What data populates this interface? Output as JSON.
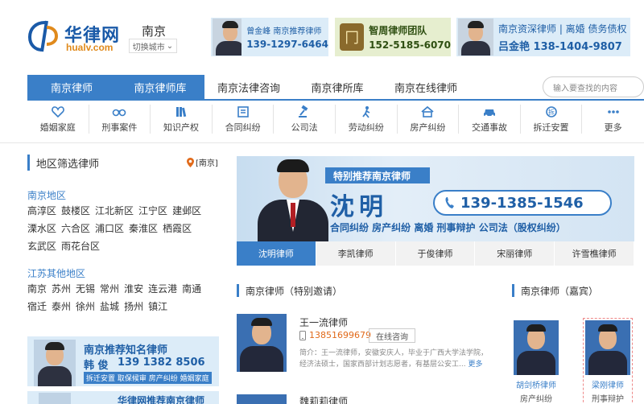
{
  "header": {
    "logo_cn": "华律网",
    "logo_en": "hualv.com",
    "city": "南京",
    "switch_city": "切换城市"
  },
  "ads": [
    {
      "line1": "曾金峰 南京推荐律师",
      "line2": "139-1297-6464"
    },
    {
      "line1": "智周律师团队",
      "line2": "152-5185-6070"
    },
    {
      "line1": "南京资深律师 | 离婚 债务债权",
      "line2": "吕金艳  138-1404-9807"
    }
  ],
  "nav": {
    "items": [
      "南京律师",
      "南京律师库",
      "南京法律咨询",
      "南京律所库",
      "南京在线律师"
    ],
    "search_placeholder": "输入要查找的内容"
  },
  "categories": [
    {
      "label": "婚姻家庭",
      "icon": "heart-icon"
    },
    {
      "label": "刑事案件",
      "icon": "handcuffs-icon"
    },
    {
      "label": "知识产权",
      "icon": "books-icon"
    },
    {
      "label": "合同纠纷",
      "icon": "contract-icon"
    },
    {
      "label": "公司法",
      "icon": "gavel-icon"
    },
    {
      "label": "劳动纠纷",
      "icon": "worker-icon"
    },
    {
      "label": "房产纠纷",
      "icon": "house-icon"
    },
    {
      "label": "交通事故",
      "icon": "car-icon"
    },
    {
      "label": "拆迁安置",
      "icon": "demolition-icon"
    },
    {
      "label": "更多",
      "icon": "more-icon"
    }
  ],
  "region": {
    "title": "地区筛选律师",
    "current": "[南京]",
    "nanjing_head": "南京地区",
    "nanjing_row1": [
      "高淳区",
      "鼓楼区",
      "江北新区",
      "江宁区",
      "建邺区"
    ],
    "nanjing_row2": [
      "溧水区",
      "六合区",
      "浦口区",
      "秦淮区",
      "栖霞区"
    ],
    "nanjing_row3": [
      "玄武区",
      "雨花台区"
    ],
    "other_head": "江苏其他地区",
    "other_row1": [
      "南京",
      "苏州",
      "无锡",
      "常州",
      "淮安",
      "连云港",
      "南通"
    ],
    "other_row2": [
      "宿迁",
      "泰州",
      "徐州",
      "盐城",
      "扬州",
      "镇江"
    ]
  },
  "promo": {
    "title": "南京推荐知名律师",
    "name": "韩 俊",
    "phone": "139 1382 8506",
    "tags": "拆迁安置  取保候审  房产纠纷  婚姻家庭",
    "title2": "华律网推荐南京律师"
  },
  "banner": {
    "tag": "特别推荐南京律师",
    "name": "沈明",
    "phone": "139-1385-1546",
    "areas": "合同纠纷  房产纠纷  离婚  刑事辩护  公司法（股权纠纷）"
  },
  "lawyer_tabs": [
    "沈明律师",
    "李凯律师",
    "于俊律师",
    "宋丽律师",
    "许雪樵律师"
  ],
  "invited": {
    "title": "南京律师（特别邀请）",
    "lawyer1": {
      "name": "王一流律师",
      "phone": "13851699679",
      "consult": "在线咨询",
      "intro": "简介：王一流律师，安徽安庆人，毕业于广西大学法学院，经济法硕士，国家西部计划志愿者，有基层公安工...",
      "more": "更多"
    },
    "lawyer2": {
      "name": "魏莉莉律师"
    }
  },
  "guests": {
    "title": "南京律师（嘉宾）",
    "items": [
      {
        "name": "胡剑桥律师",
        "specialty": "房产纠纷"
      },
      {
        "name": "梁刚律师",
        "specialty": "刑事辩护"
      }
    ]
  }
}
